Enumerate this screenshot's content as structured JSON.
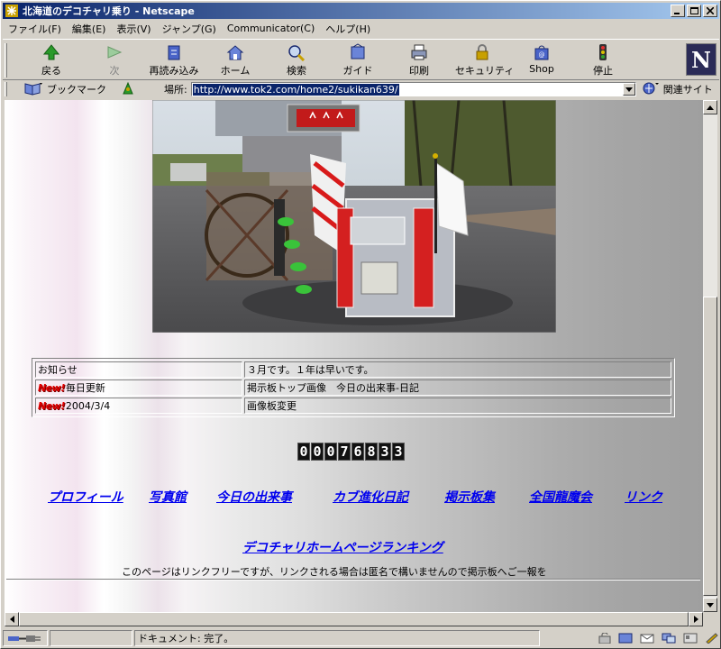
{
  "window": {
    "title": "北海道のデコチャリ乗り - Netscape"
  },
  "menu": [
    "ファイル(F)",
    "編集(E)",
    "表示(V)",
    "ジャンプ(G)",
    "Communicator(C)",
    "ヘルプ(H)"
  ],
  "toolbar": {
    "back": "戻る",
    "forward": "次",
    "reload": "再読み込み",
    "home": "ホーム",
    "search": "検索",
    "guide": "ガイド",
    "print": "印刷",
    "security": "セキュリティ",
    "shop": "Shop",
    "stop": "停止",
    "logo": "N"
  },
  "location": {
    "bookmarks": "ブックマーク",
    "label": "場所:",
    "url": "http://www.tok2.com/home2/sukikan639/",
    "related": "関連サイト"
  },
  "news": {
    "rows": [
      {
        "badge": "",
        "left": "お知らせ",
        "right": "３月です。１年は早いです。"
      },
      {
        "badge": "New!",
        "left": "毎日更新",
        "right": "掲示板トップ画像　今日の出来事-日記"
      },
      {
        "badge": "New!",
        "left": "2004/3/4",
        "right": "画像板変更"
      }
    ]
  },
  "counter": {
    "digits": [
      "0",
      "0",
      "0",
      "7",
      "6",
      "8",
      "3",
      "3"
    ]
  },
  "nav": {
    "profile": "プロフィール",
    "photos": "写真館",
    "today": "今日の出来事",
    "cub": "カブ進化日記",
    "bbs": "掲示板集",
    "national": "全国龍魔会",
    "links": "リンク"
  },
  "ranking": "デコチャリホームページランキング",
  "notice": "このページはリンクフリーですが、リンクされる場合は匿名で構いませんので掲示板へご一報を",
  "status": {
    "text": "ドキュメント: 完了。"
  },
  "colors": {
    "link": "#0000ee",
    "titlebar": "#0a246a",
    "new_badge": "#e00000"
  }
}
